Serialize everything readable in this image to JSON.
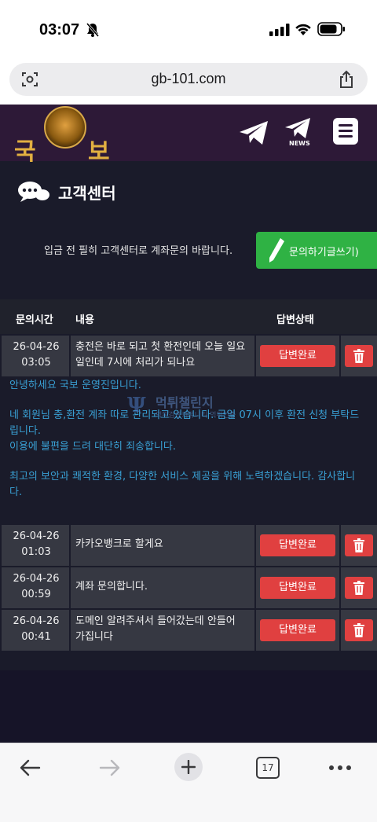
{
  "status_bar": {
    "time": "03:07",
    "icons": [
      "bell-slash-icon",
      "signal-icon",
      "wifi-icon",
      "battery-icon"
    ]
  },
  "browser": {
    "url": "gb-101.com",
    "tab_count": "17",
    "icons": [
      "page-settings-icon",
      "share-icon",
      "back-icon",
      "forward-icon",
      "new-tab-icon",
      "more-icon"
    ]
  },
  "site": {
    "logo_left": "국",
    "logo_right": "보",
    "news_label": "NEWS",
    "header_icons": [
      "telegram-icon",
      "news-icon",
      "menu-icon"
    ]
  },
  "page": {
    "title": "고객센터",
    "notice": "입금 전 필히 고객센터로 계좌문의 바랍니다.",
    "write_button": "문의하기글쓰기)"
  },
  "table": {
    "headers": {
      "time": "문의시간",
      "content": "내용",
      "status": "답변상태"
    },
    "rows": [
      {
        "date": "26-04-26",
        "time": "03:05",
        "content_line1": "충전은 바로 되고 첫 환전인데 오늘 일요",
        "content_line2": "일인데 7시에 처리가 되나요",
        "status": "답변완료"
      },
      {
        "date": "26-04-26",
        "time": "01:03",
        "content_line1": "카카오뱅크로 할게요",
        "content_line2": "",
        "status": "답변완료"
      },
      {
        "date": "26-04-26",
        "time": "00:59",
        "content_line1": "계좌 문의합니다.",
        "content_line2": "",
        "status": "답변완료"
      },
      {
        "date": "26-04-26",
        "time": "00:41",
        "content_line1": "도메인 알려주셔서 들어갔는데 안들어",
        "content_line2": "가집니다",
        "status": "답변완료"
      }
    ]
  },
  "reply": {
    "line1": "안녕하세요 국보 운영진입니다.",
    "line2": "네 회원님 충,환전 계좌 따로 관리되고 있습니다. 금일 07시 이후 환전 신청 부탁드",
    "line3": "립니다.",
    "line4": "이용에 불편을 드려 대단히 죄송합니다.",
    "line5": "최고의 보안과 쾌적한 환경, 다양한 서비스 제공을 위해 노력하겠습니다. 감사합니",
    "line6": "다."
  },
  "watermark": {
    "text": "먹튀챌린지",
    "sub": "먹튀검증커뮤니티 먹튀인증"
  },
  "colors": {
    "header_bg": "#2d1937",
    "page_bg": "#1a1b2a",
    "accent_green": "#2fb244",
    "status_red": "#e04040",
    "reply_blue": "#39a0d4",
    "logo_gold": "#e2b041"
  }
}
